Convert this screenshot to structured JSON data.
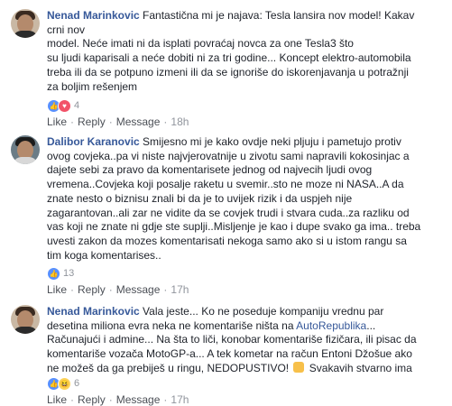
{
  "comments": [
    {
      "author": "Nenad Marinkovic",
      "text": "Fantastična mi je najava: Tesla lansira nov model! Kakav\ncrni nov\nmodel. Neće imati ni da isplati povraćaj novca za one Tesla3 što\nsu ljudi kaparisali a neće dobiti ni za tri godine... Koncept elektro-automobila\ntreba ili da se potpuno izmeni ili da se ignoriše do iskorenjavanja u potražnji\nza boljim rešenjem",
      "reaction_count": "4",
      "like": "Like",
      "reply": "Reply",
      "message": "Message",
      "time": "18h"
    },
    {
      "author": "Dalibor Karanovic",
      "text": "Smijesno mi je kako ovdje neki pljuju i pametujo protiv\novog covjeka..pa vi niste najvjerovatnije u zivotu sami napravili kokosinjac a\ndajete sebi za pravo da komentarisete jednog od najvecih ljudi ovog\nvremena..Covjeka koji posalje raketu u svemir..sto ne moze ni NASA..A da\nznate nesto o biznisu znali bi da je to uvijek rizik i da uspjeh nije\nzagarantovan..ali zar ne vidite da se covjek trudi i stvara cuda..za razliku od\nvas koji ne znate ni gdje ste suplji..Misljenje je kao i dupe svako ga ima.. treba\nuvesti zakon da mozes komentarisati nekoga samo ako si u istom rangu sa\ntim koga komentarises..",
      "reaction_count": "13",
      "like": "Like",
      "reply": "Reply",
      "message": "Message",
      "time": "17h"
    },
    {
      "author": "Nenad Marinkovic",
      "text_before_link": "Vala jeste... Ko ne poseduje kompaniju vrednu par\ndesetina miliona evra neka ne komentariše ništa na ",
      "link_text": "AutoRepublika",
      "text_after_link": "...\nRačunajući i admine... Na šta to liči, konobar komentariše fizičara, ili pisac da\nkomentariše vozača MotoGP-a... A tek kometar na račun Entoni Džošue ako\nne možeš da ga prebiješ u ringu, NEDOPUSTIVO!",
      "text_end": " Svakavih stvarno ima",
      "reaction_count": "6",
      "like": "Like",
      "reply": "Reply",
      "message": "Message",
      "time": "17h"
    }
  ]
}
